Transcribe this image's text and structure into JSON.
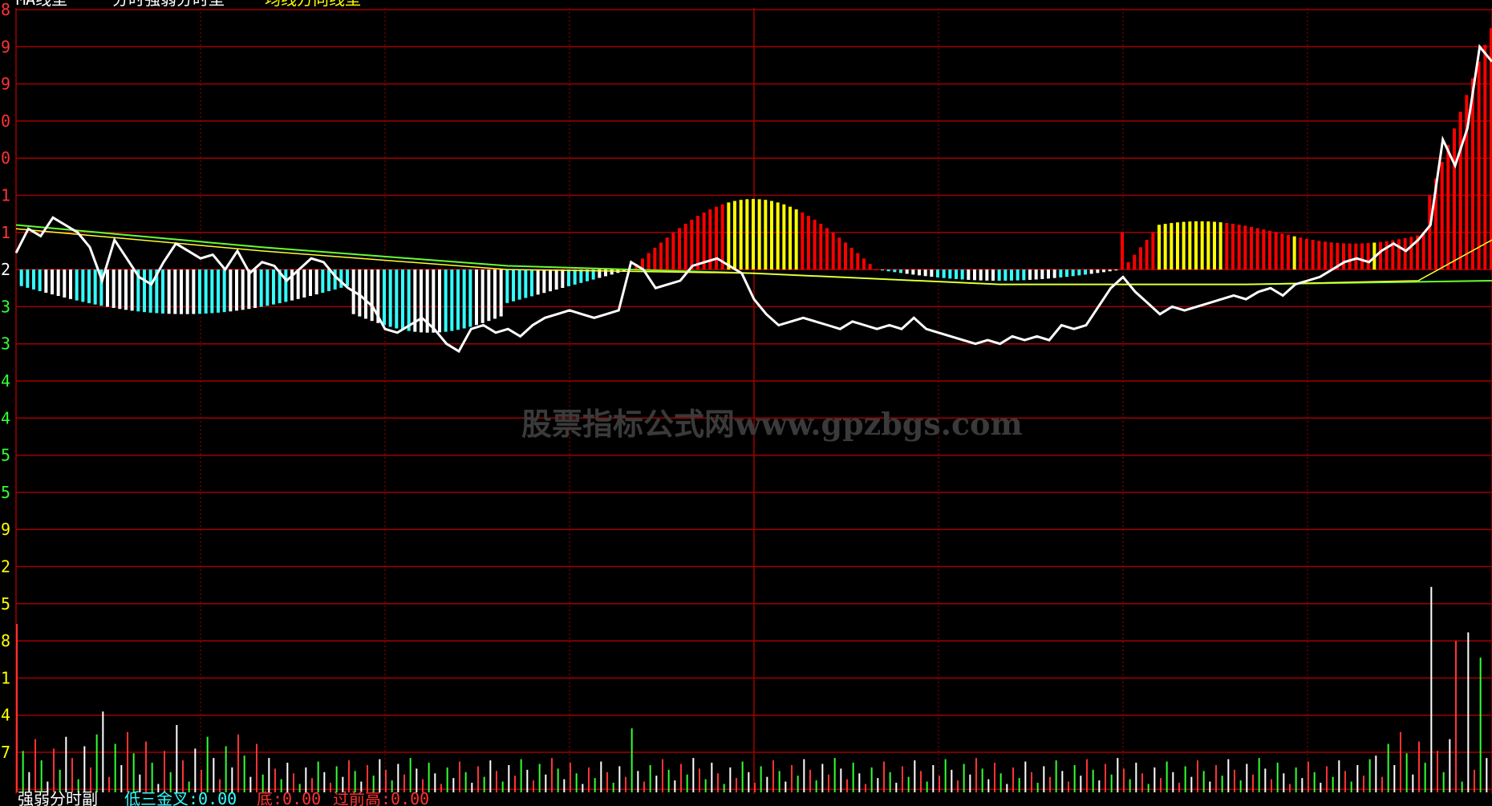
{
  "watermark": "股票指标公式网www.gpzbgs.com",
  "colors": {
    "background": "#000000",
    "grid": "#a00000",
    "price_line": "#ffffff",
    "avg_line_green": "#66ff33",
    "avg_line_yellow": "#ffff33",
    "bar_up_red": "#ff0000",
    "bar_up_yellow": "#ffff00",
    "bar_down_cyan": "#33ffff",
    "bar_down_white": "#ffffff",
    "vol_red": "#ff3333",
    "vol_green": "#33ff33",
    "vol_white": "#ffffff",
    "axis_label": "#ff3333",
    "axis_label_green": "#33ff33",
    "axis_label_yellow": "#ffff00"
  },
  "chart_data": [
    {
      "type": "line",
      "panel": "price",
      "left_axis_tick_labels": [
        "8",
        "9",
        "9",
        "0",
        "0",
        "1",
        "1",
        "2",
        "3",
        "3",
        "4",
        "4",
        "5",
        "5"
      ],
      "baseline_tick_index": 7,
      "grid": true,
      "x_range": [
        0,
        240
      ],
      "price_series": [
        [
          0,
          0.45
        ],
        [
          2,
          1.1
        ],
        [
          4,
          0.9
        ],
        [
          6,
          1.4
        ],
        [
          8,
          1.2
        ],
        [
          10,
          1.0
        ],
        [
          12,
          0.6
        ],
        [
          14,
          -0.3
        ],
        [
          16,
          0.8
        ],
        [
          18,
          0.3
        ],
        [
          20,
          -0.2
        ],
        [
          22,
          -0.4
        ],
        [
          24,
          0.2
        ],
        [
          26,
          0.7
        ],
        [
          28,
          0.5
        ],
        [
          30,
          0.3
        ],
        [
          32,
          0.4
        ],
        [
          34,
          0.0
        ],
        [
          36,
          0.5
        ],
        [
          38,
          -0.1
        ],
        [
          40,
          0.2
        ],
        [
          42,
          0.1
        ],
        [
          44,
          -0.3
        ],
        [
          46,
          0.0
        ],
        [
          48,
          0.3
        ],
        [
          50,
          0.2
        ],
        [
          52,
          -0.2
        ],
        [
          54,
          -0.5
        ],
        [
          56,
          -0.7
        ],
        [
          58,
          -1.0
        ],
        [
          60,
          -1.6
        ],
        [
          62,
          -1.7
        ],
        [
          64,
          -1.5
        ],
        [
          66,
          -1.3
        ],
        [
          68,
          -1.6
        ],
        [
          70,
          -2.0
        ],
        [
          72,
          -2.2
        ],
        [
          74,
          -1.6
        ],
        [
          76,
          -1.5
        ],
        [
          78,
          -1.7
        ],
        [
          80,
          -1.6
        ],
        [
          82,
          -1.8
        ],
        [
          84,
          -1.5
        ],
        [
          86,
          -1.3
        ],
        [
          88,
          -1.2
        ],
        [
          90,
          -1.1
        ],
        [
          92,
          -1.2
        ],
        [
          94,
          -1.3
        ],
        [
          96,
          -1.2
        ],
        [
          98,
          -1.1
        ],
        [
          100,
          0.2
        ],
        [
          102,
          0.0
        ],
        [
          104,
          -0.5
        ],
        [
          106,
          -0.4
        ],
        [
          108,
          -0.3
        ],
        [
          110,
          0.1
        ],
        [
          112,
          0.2
        ],
        [
          114,
          0.3
        ],
        [
          116,
          0.1
        ],
        [
          118,
          -0.1
        ],
        [
          120,
          -0.8
        ],
        [
          122,
          -1.2
        ],
        [
          124,
          -1.5
        ],
        [
          126,
          -1.4
        ],
        [
          128,
          -1.3
        ],
        [
          130,
          -1.4
        ],
        [
          132,
          -1.5
        ],
        [
          134,
          -1.6
        ],
        [
          136,
          -1.4
        ],
        [
          138,
          -1.5
        ],
        [
          140,
          -1.6
        ],
        [
          142,
          -1.5
        ],
        [
          144,
          -1.6
        ],
        [
          146,
          -1.3
        ],
        [
          148,
          -1.6
        ],
        [
          150,
          -1.7
        ],
        [
          152,
          -1.8
        ],
        [
          154,
          -1.9
        ],
        [
          156,
          -2.0
        ],
        [
          158,
          -1.9
        ],
        [
          160,
          -2.0
        ],
        [
          162,
          -1.8
        ],
        [
          164,
          -1.9
        ],
        [
          166,
          -1.8
        ],
        [
          168,
          -1.9
        ],
        [
          170,
          -1.5
        ],
        [
          172,
          -1.6
        ],
        [
          174,
          -1.5
        ],
        [
          176,
          -1.0
        ],
        [
          178,
          -0.5
        ],
        [
          180,
          -0.2
        ],
        [
          182,
          -0.6
        ],
        [
          184,
          -0.9
        ],
        [
          186,
          -1.2
        ],
        [
          188,
          -1.0
        ],
        [
          190,
          -1.1
        ],
        [
          192,
          -1.0
        ],
        [
          194,
          -0.9
        ],
        [
          196,
          -0.8
        ],
        [
          198,
          -0.7
        ],
        [
          200,
          -0.8
        ],
        [
          202,
          -0.6
        ],
        [
          204,
          -0.5
        ],
        [
          206,
          -0.7
        ],
        [
          208,
          -0.4
        ],
        [
          210,
          -0.3
        ],
        [
          212,
          -0.2
        ],
        [
          214,
          0.0
        ],
        [
          216,
          0.2
        ],
        [
          218,
          0.3
        ],
        [
          220,
          0.2
        ],
        [
          222,
          0.5
        ],
        [
          224,
          0.7
        ],
        [
          226,
          0.5
        ],
        [
          228,
          0.8
        ],
        [
          230,
          1.2
        ],
        [
          232,
          3.5
        ],
        [
          234,
          2.8
        ],
        [
          236,
          3.8
        ],
        [
          238,
          6.0
        ],
        [
          239,
          5.8
        ],
        [
          240,
          5.6
        ]
      ],
      "avg_green_series": [
        [
          0,
          1.2
        ],
        [
          40,
          0.6
        ],
        [
          80,
          0.1
        ],
        [
          120,
          -0.1
        ],
        [
          160,
          -0.4
        ],
        [
          200,
          -0.4
        ],
        [
          240,
          -0.3
        ]
      ],
      "avg_yellow_series": [
        [
          0,
          1.1
        ],
        [
          40,
          0.5
        ],
        [
          80,
          0.0
        ],
        [
          120,
          -0.1
        ],
        [
          160,
          -0.4
        ],
        [
          200,
          -0.4
        ],
        [
          228,
          -0.3
        ],
        [
          240,
          0.8
        ]
      ]
    },
    {
      "type": "bar",
      "panel": "volume",
      "left_axis_tick_labels": [
        "9",
        "2",
        "5",
        "8",
        "1",
        "4",
        "7"
      ],
      "grid": true,
      "x_range": [
        0,
        240
      ],
      "spike_volumes": [
        [
          0,
          100
        ],
        [
          14,
          48
        ],
        [
          26,
          40
        ],
        [
          100,
          38
        ],
        [
          230,
          122
        ],
        [
          234,
          90
        ],
        [
          236,
          95
        ],
        [
          238,
          80
        ]
      ]
    }
  ],
  "footer": {
    "text_white": "强弱分时副",
    "text_cyan": "低三金叉:0.00",
    "text_red1": "底:0.00",
    "text_red2": "过前高:0.00"
  },
  "header": {
    "text_white": "MA线型",
    "text_white2": "分时强弱分时型",
    "text_yellow": "均线方向线型"
  }
}
